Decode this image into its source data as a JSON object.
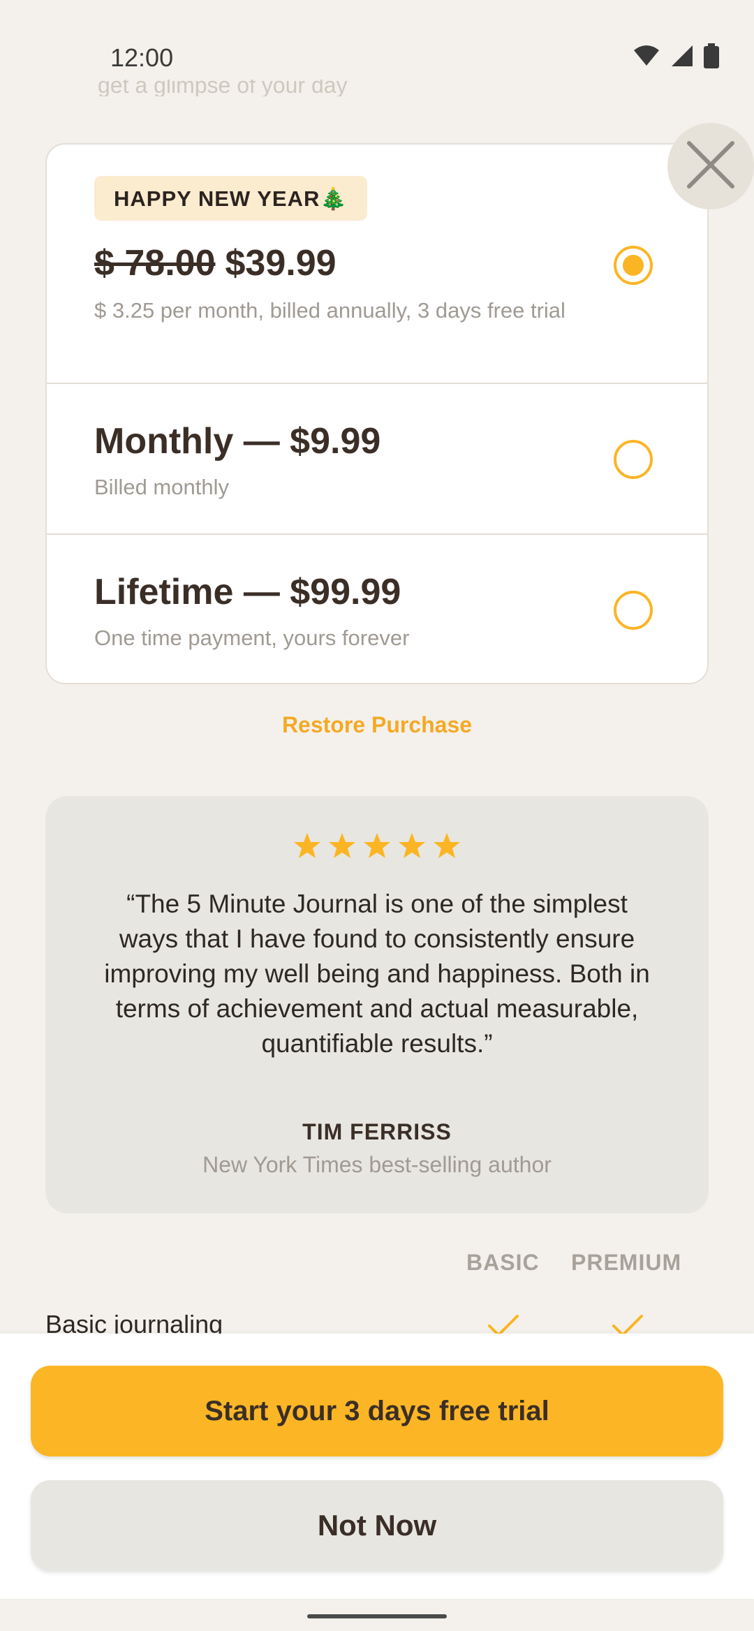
{
  "status_bar": {
    "time": "12:00",
    "icons": [
      "wifi-icon",
      "signal-icon",
      "battery-icon"
    ]
  },
  "header": {
    "faded_text": "get a glimpse of your day"
  },
  "close_icon": "close-icon",
  "plans": {
    "selected": 0,
    "promo": {
      "badge": "HAPPY NEW YEAR🎄",
      "old_price": "$ 78.00",
      "price": "$39.99",
      "subtitle": "$ 3.25 per month, billed annually, 3 days free trial"
    },
    "monthly": {
      "title": "Monthly — $9.99",
      "subtitle": "Billed monthly"
    },
    "lifetime": {
      "title": "Lifetime — $99.99",
      "subtitle": "One time payment, yours forever"
    }
  },
  "restore_label": "Restore Purchase",
  "testimonial": {
    "rating": 5,
    "quote": "“The 5 Minute Journal is one of the simplest ways that I have found to consistently ensure improving my well being and happiness. Both in terms of achievement and actual measurable, quantifiable results.”",
    "author": "TIM FERRISS",
    "author_title": "New York Times best-selling author"
  },
  "comparison": {
    "columns": [
      "BASIC",
      "PREMIUM"
    ],
    "rows": [
      {
        "feature": "Basic journaling",
        "basic": true,
        "premium": true
      }
    ]
  },
  "actions": {
    "primary": "Start your 3 days free trial",
    "secondary": "Not Now"
  },
  "colors": {
    "accent": "#FCB625",
    "background": "#F4F1EC",
    "text": "#3A2E27"
  }
}
